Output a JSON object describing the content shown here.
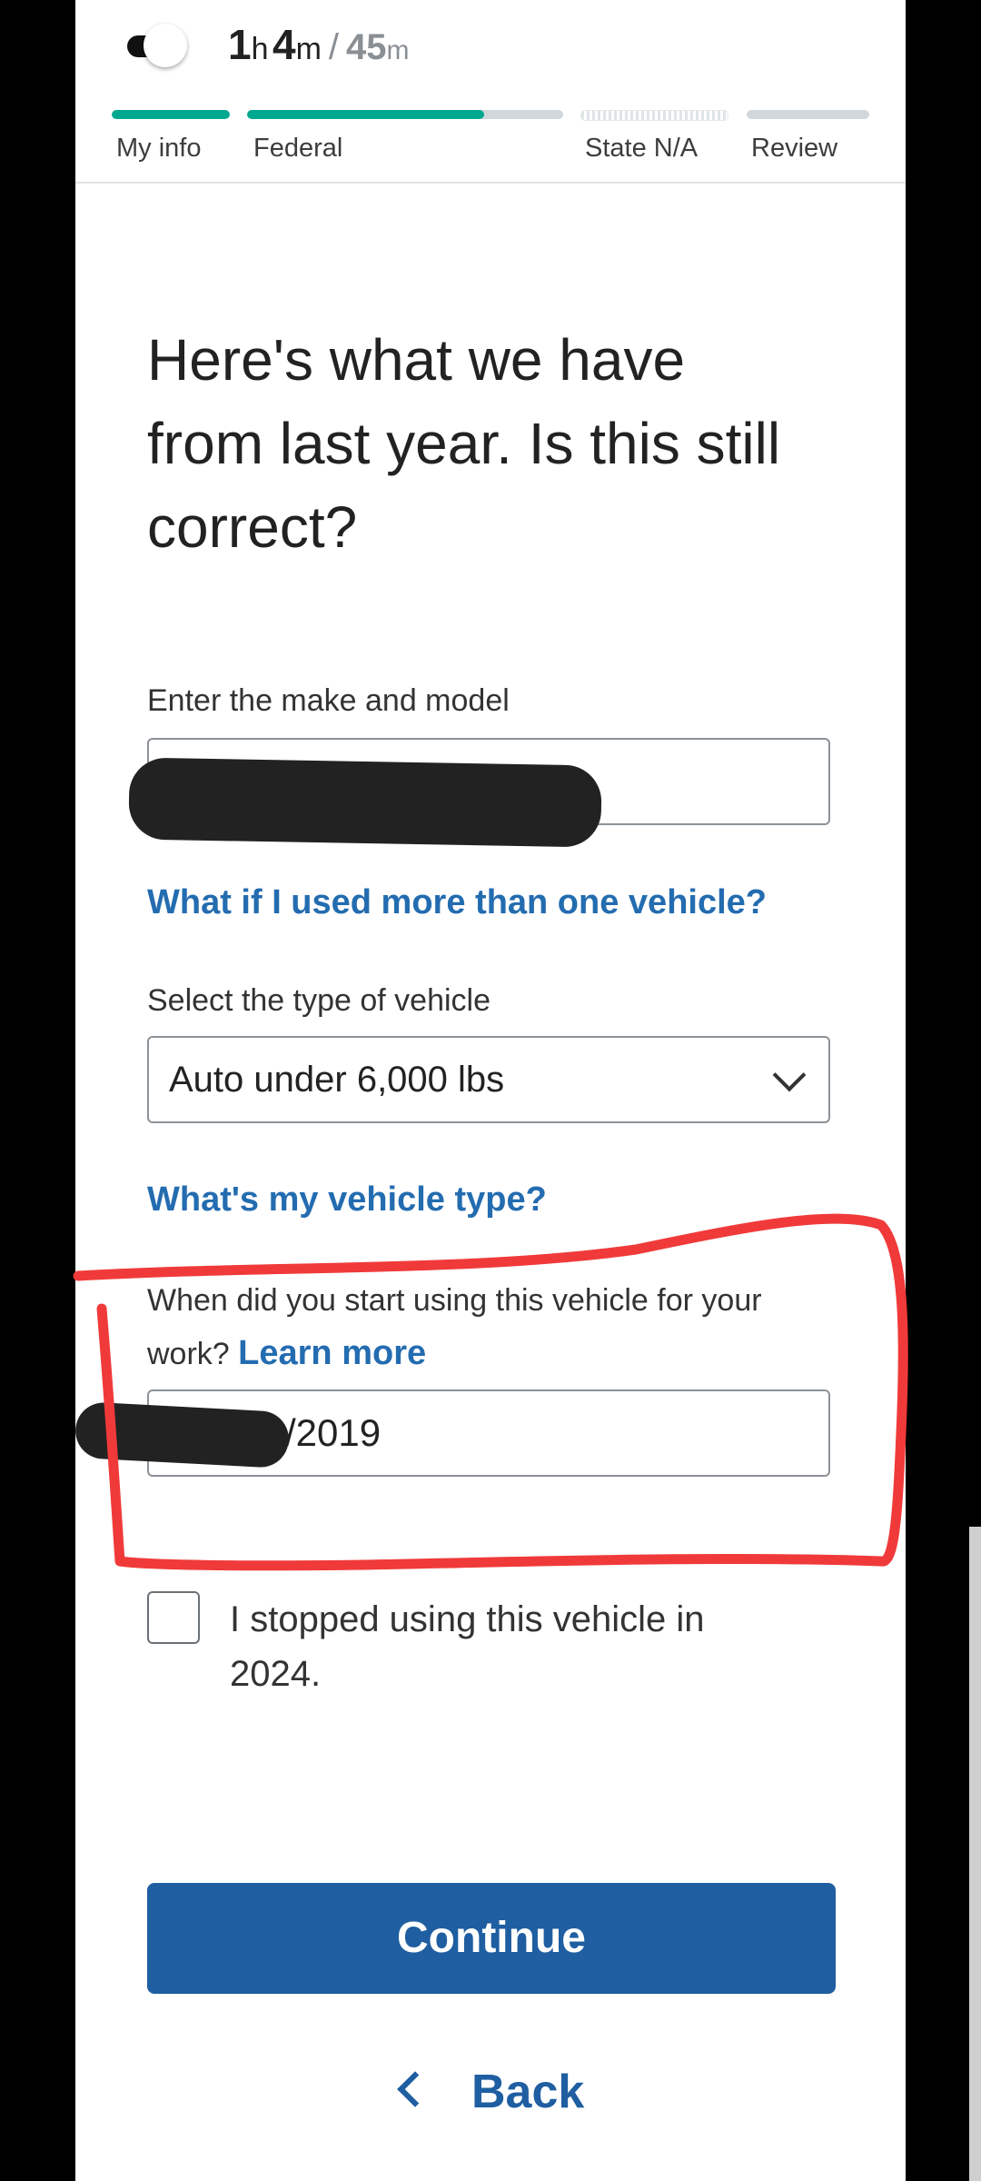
{
  "header": {
    "timer_hours": "1",
    "timer_hours_unit": "h",
    "timer_minutes": "4",
    "timer_minutes_unit": "m",
    "timer_separator": "/",
    "estimate": "45",
    "estimate_unit": "m",
    "steps": [
      {
        "label": "My info",
        "progress": 1.0
      },
      {
        "label": "Federal",
        "progress": 0.75
      },
      {
        "label": "State N/A",
        "progress": 0
      },
      {
        "label": "Review",
        "progress": 0
      }
    ],
    "toggle_on": true
  },
  "main": {
    "heading": "Here's what we have from last year. Is this still correct?",
    "make_model": {
      "label": "Enter the make and model",
      "value": ""
    },
    "multi_vehicle_link": "What if I used more than one vehicle?",
    "vehicle_type": {
      "label": "Select the type of vehicle",
      "value": "Auto under 6,000 lbs"
    },
    "vehicle_type_link": "What's my vehicle type?",
    "start_date": {
      "label": "When did you start using this vehicle for your work?",
      "learn_more": "Learn more",
      "value": "/2019"
    },
    "stopped": {
      "label": "I stopped using this vehicle in 2024.",
      "checked": false
    },
    "continue_label": "Continue",
    "back_label": "Back"
  },
  "colors": {
    "accent": "#236cb0",
    "button": "#1f5ea1",
    "progress": "#00a88f",
    "annotation": "#f03a3a"
  }
}
